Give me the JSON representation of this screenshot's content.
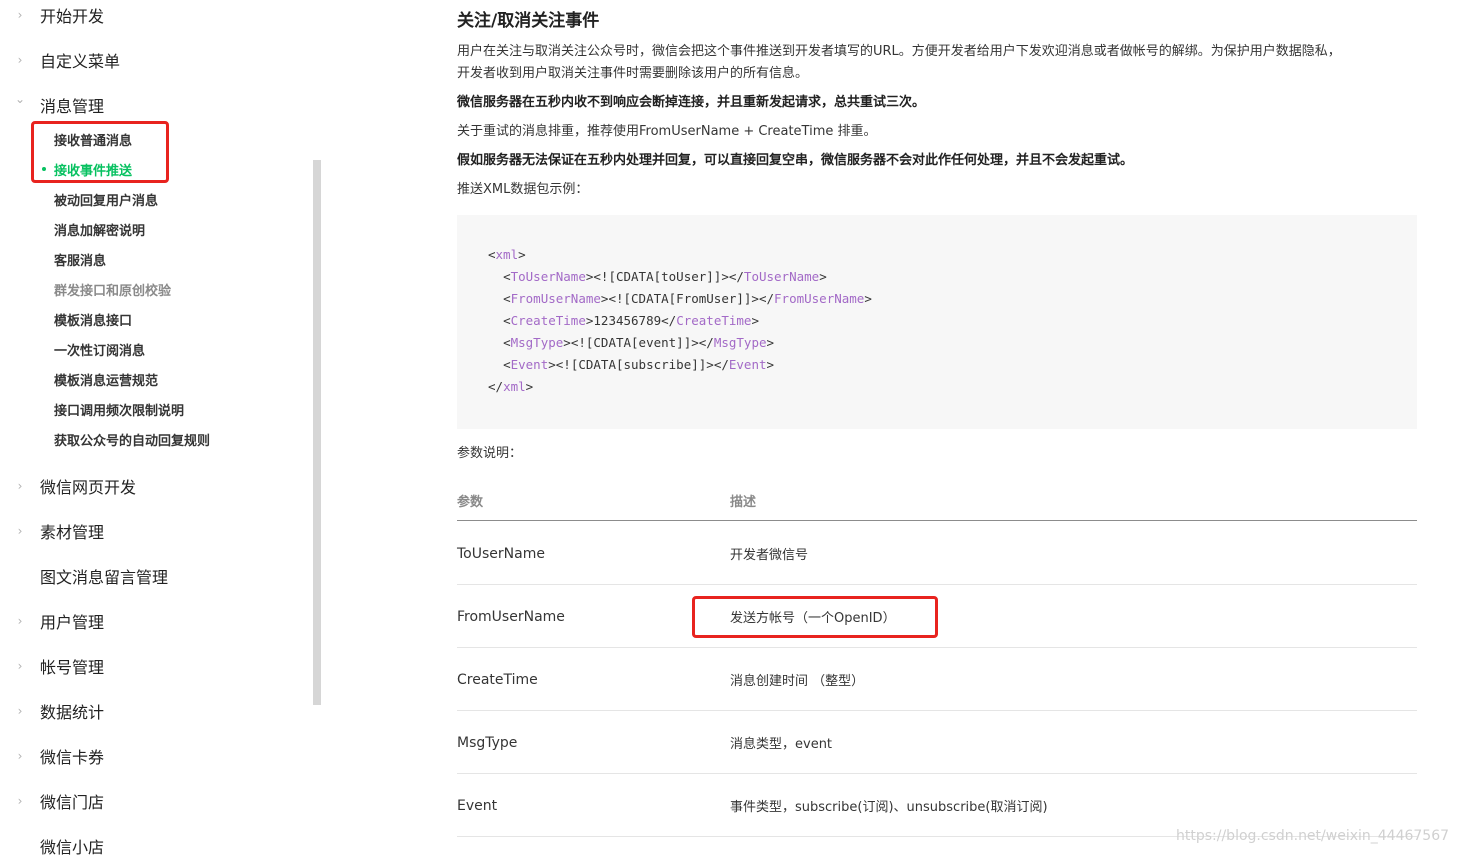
{
  "sidebar": {
    "top_items": [
      {
        "label": "开始开发",
        "expanded": false
      },
      {
        "label": "自定义菜单",
        "expanded": false
      },
      {
        "label": "消息管理",
        "expanded": true
      }
    ],
    "sub_items": [
      {
        "label": "接收普通消息",
        "state": "normal"
      },
      {
        "label": "接收事件推送",
        "state": "active"
      },
      {
        "label": "被动回复用户消息",
        "state": "normal"
      },
      {
        "label": "消息加解密说明",
        "state": "normal"
      },
      {
        "label": "客服消息",
        "state": "normal"
      },
      {
        "label": "群发接口和原创校验",
        "state": "dim"
      },
      {
        "label": "模板消息接口",
        "state": "normal"
      },
      {
        "label": "一次性订阅消息",
        "state": "normal"
      },
      {
        "label": "模板消息运营规范",
        "state": "normal"
      },
      {
        "label": "接口调用频次限制说明",
        "state": "normal"
      },
      {
        "label": "获取公众号的自动回复规则",
        "state": "normal"
      }
    ],
    "bottom_items": [
      {
        "label": "微信网页开发",
        "chevron": true
      },
      {
        "label": "素材管理",
        "chevron": true
      },
      {
        "label": "图文消息留言管理",
        "chevron": false
      },
      {
        "label": "用户管理",
        "chevron": true
      },
      {
        "label": "帐号管理",
        "chevron": true
      },
      {
        "label": "数据统计",
        "chevron": true
      },
      {
        "label": "微信卡券",
        "chevron": true
      },
      {
        "label": "微信门店",
        "chevron": true
      },
      {
        "label": "微信小店",
        "chevron": false
      }
    ],
    "chevron_right": "›",
    "chevron_down": "⌄"
  },
  "content": {
    "title": "关注/取消关注事件",
    "intro_line1": "用户在关注与取消关注公众号时，微信会把这个事件推送到开发者填写的URL。方便开发者给用户下发欢迎消息或者做帐号的解绑。为保护用户数据隐私，",
    "intro_line2": "开发者收到用户取消关注事件时需要删除该用户的所有信息。",
    "bold_line1": "微信服务器在五秒内收不到响应会断掉连接，并且重新发起请求，总共重试三次。",
    "retry_line": "关于重试的消息排重，推荐使用FromUserName + CreateTime 排重。",
    "bold_line2": "假如服务器无法保证在五秒内处理并回复，可以直接回复空串，微信服务器不会对此作任何处理，并且不会发起重试。",
    "xml_intro": "推送XML数据包示例：",
    "code": {
      "root_tag": "xml",
      "fields": [
        {
          "tag": "ToUserName",
          "value": "<![CDATA[toUser]]>"
        },
        {
          "tag": "FromUserName",
          "value": "<![CDATA[FromUser]]>"
        },
        {
          "tag": "CreateTime",
          "value": "123456789"
        },
        {
          "tag": "MsgType",
          "value": "<![CDATA[event]]>"
        },
        {
          "tag": "Event",
          "value": "<![CDATA[subscribe]]>"
        }
      ]
    },
    "params_label": "参数说明：",
    "table": {
      "headers": [
        "参数",
        "描述"
      ],
      "rows": [
        {
          "param": "ToUserName",
          "desc": "开发者微信号"
        },
        {
          "param": "FromUserName",
          "desc": "发送方帐号（一个OpenID）"
        },
        {
          "param": "CreateTime",
          "desc": "消息创建时间 （整型）"
        },
        {
          "param": "MsgType",
          "desc": "消息类型，event"
        },
        {
          "param": "Event",
          "desc": "事件类型，subscribe(订阅)、unsubscribe(取消订阅)"
        }
      ]
    }
  },
  "watermark": "https://blog.csdn.net/weixin_44467567",
  "colors": {
    "accent": "#07c160",
    "highlight_box": "#e8231f",
    "xml_tag": "#a36ac7"
  }
}
